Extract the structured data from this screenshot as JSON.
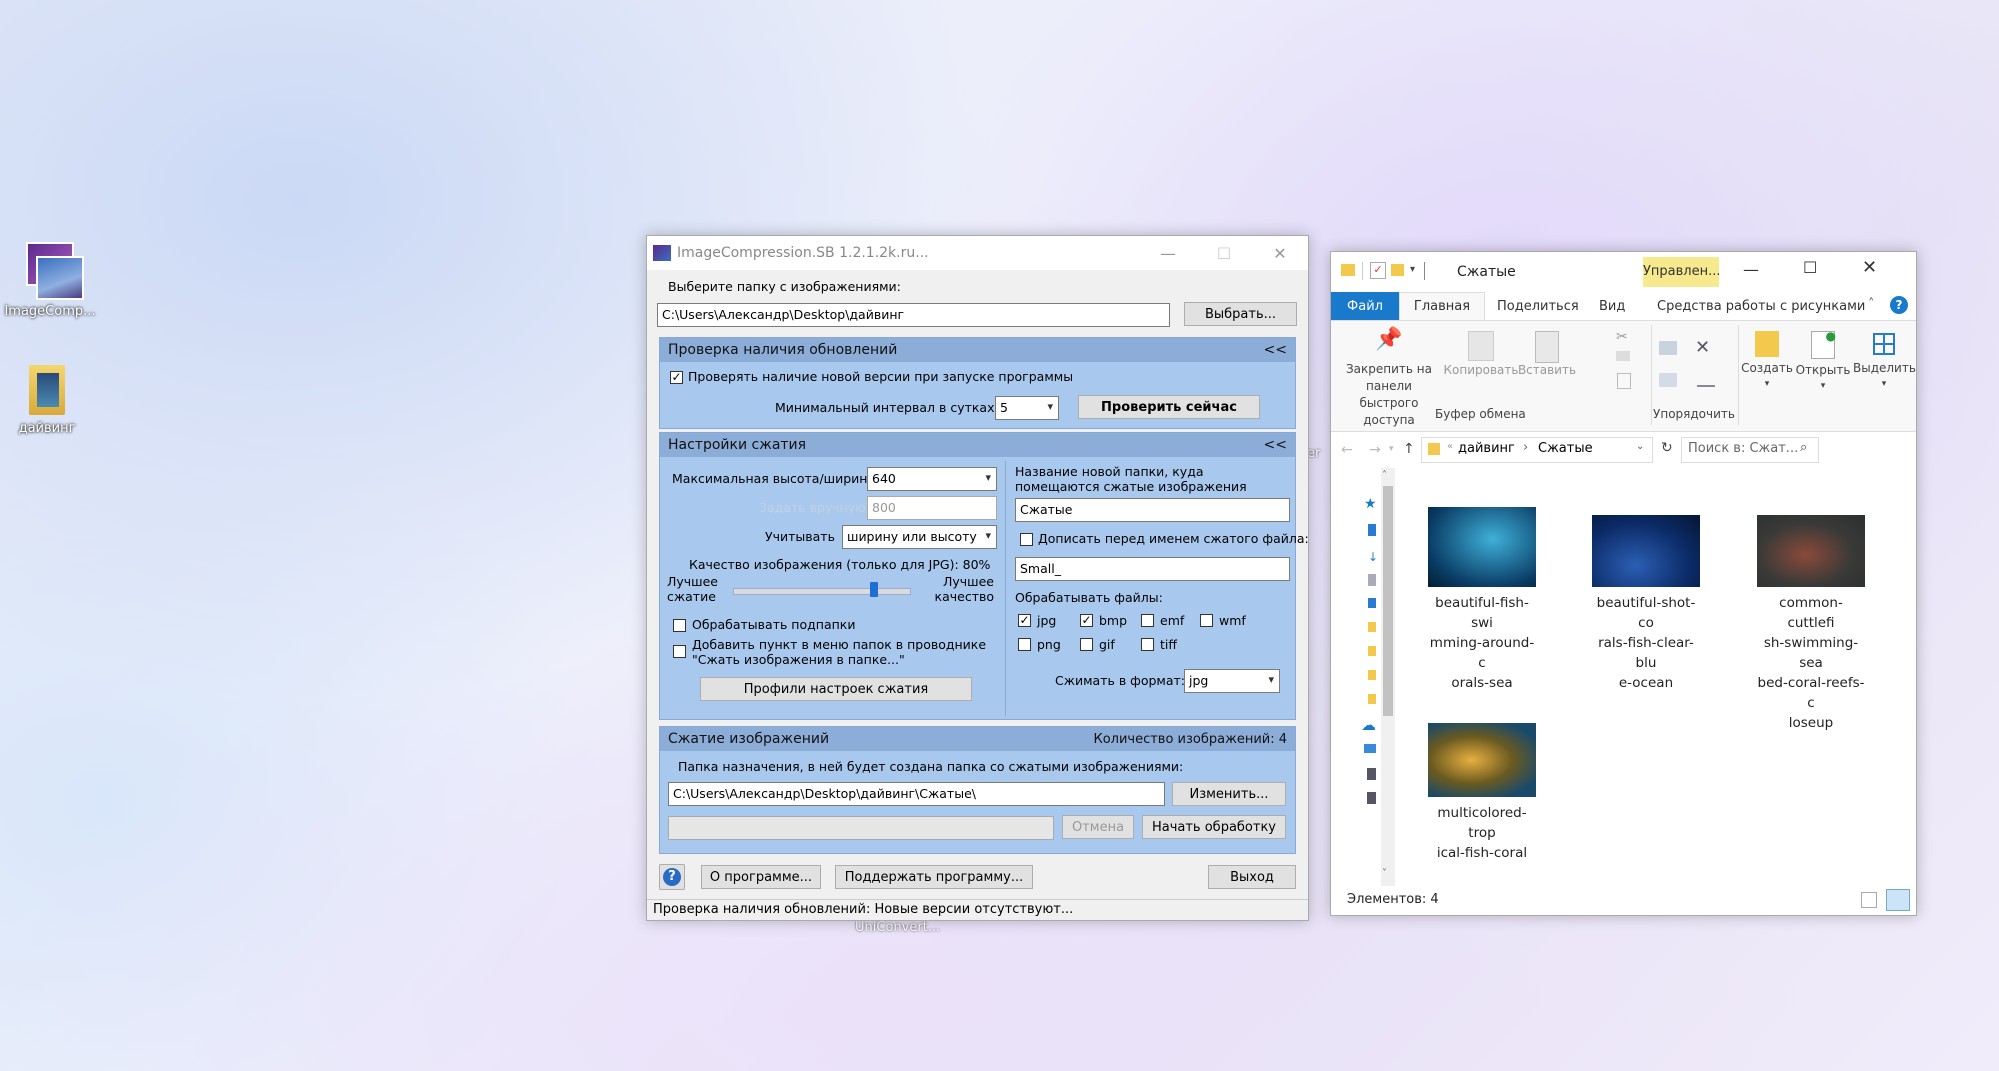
{
  "desktop": {
    "icons": [
      {
        "label": "ImageComp..."
      },
      {
        "label": "дайвинг"
      }
    ],
    "partial_label": "UniConvert...",
    "partial_edge": "er"
  },
  "ic": {
    "title": "ImageCompression.SB 1.2.1.2k.ru...",
    "folder_label": "Выберите папку с изображениями:",
    "folder_value": "C:\\Users\\Александр\\Desktop\\дайвинг",
    "browse": "Выбрать...",
    "updates": {
      "header": "Проверка наличия обновлений",
      "collapse": "<<",
      "check_label": "Проверять наличие новой версии при запуске программы",
      "interval_label": "Минимальный интервал в сутках:",
      "interval_value": "5",
      "check_now": "Проверить сейчас"
    },
    "settings": {
      "header": "Настройки сжатия",
      "collapse": "<<",
      "max_label": "Максимальная высота/ширина",
      "max_value": "640",
      "manual_label": "Задать вручную",
      "manual_value": "800",
      "consider_label": "Учитывать",
      "consider_value": "ширину или высоту",
      "quality_label": "Качество изображения (только для JPG): 80%",
      "quality": 80,
      "better_compress": "Лучшее сжатие",
      "better_quality": "Лучшее качество",
      "subfolders": "Обрабатывать подпапки",
      "context_menu": "Добавить пункт в меню папок в проводнике \"Сжать изображения в папке...\"",
      "profiles": "Профили настроек сжатия",
      "newfolder_label": "Название новой папки, куда помещаются сжатые изображения",
      "newfolder_value": "Сжатые",
      "prefix_label": "Дописать перед именем сжатого файла:",
      "prefix_value": "Small_",
      "process_label": "Обрабатывать файлы:",
      "types": [
        {
          "name": "jpg",
          "checked": true
        },
        {
          "name": "bmp",
          "checked": true
        },
        {
          "name": "emf",
          "checked": false
        },
        {
          "name": "wmf",
          "checked": false
        },
        {
          "name": "png",
          "checked": false
        },
        {
          "name": "gif",
          "checked": false
        },
        {
          "name": "tiff",
          "checked": false
        }
      ],
      "format_label": "Сжимать в формат:",
      "format_value": "jpg"
    },
    "compress": {
      "header": "Сжатие изображений",
      "count": "Количество изображений: 4",
      "dest_label": "Папка назначения, в ней будет создана папка со сжатыми изображениями:",
      "dest_value": "C:\\Users\\Александр\\Desktop\\дайвинг\\Сжатые\\",
      "change": "Изменить...",
      "cancel": "Отмена",
      "start": "Начать обработку"
    },
    "about": "О программе...",
    "support": "Поддержать программу...",
    "exit": "Выход",
    "status": "Проверка наличия обновлений: Новые версии отсутствуют..."
  },
  "explorer": {
    "title": "Сжатые",
    "manage_tab": "Управлен...",
    "tabs": [
      "Файл",
      "Главная",
      "Поделиться",
      "Вид",
      "Средства работы с рисунками"
    ],
    "ribbon": {
      "pin": "Закрепить на панели быстрого доступа",
      "copy": "Копировать",
      "paste": "Вставить",
      "clipboard_group": "Буфер обмена",
      "organize_group": "Упорядочить",
      "create": "Создать",
      "open": "Открыть",
      "select": "Выделить"
    },
    "path": [
      "дайвинг",
      "Сжатые"
    ],
    "search_placeholder": "Поиск в: Сжат...",
    "files": [
      {
        "name": "beautiful-fish-swimming-around-corals-sea",
        "lines": [
          "beautiful-fish-swi",
          "mming-around-c",
          "orals-sea"
        ]
      },
      {
        "name": "beautiful-shot-corals-fish-clear-blue-ocean",
        "lines": [
          "beautiful-shot-co",
          "rals-fish-clear-blu",
          "e-ocean"
        ]
      },
      {
        "name": "common-cuttlefish-swimming-seabed-coral-reefs-closeup",
        "lines": [
          "common-cuttlefi",
          "sh-swimming-sea",
          "bed-coral-reefs-c",
          "loseup"
        ]
      },
      {
        "name": "multicolored-tropical-fish-coral",
        "lines": [
          "multicolored-trop",
          "ical-fish-coral"
        ]
      }
    ],
    "status": "Элементов: 4"
  },
  "colors": {
    "accent": "#1979ca",
    "panel": "#a9c8ee",
    "panel_head": "#8dadd9",
    "manage": "#f7e98e"
  }
}
